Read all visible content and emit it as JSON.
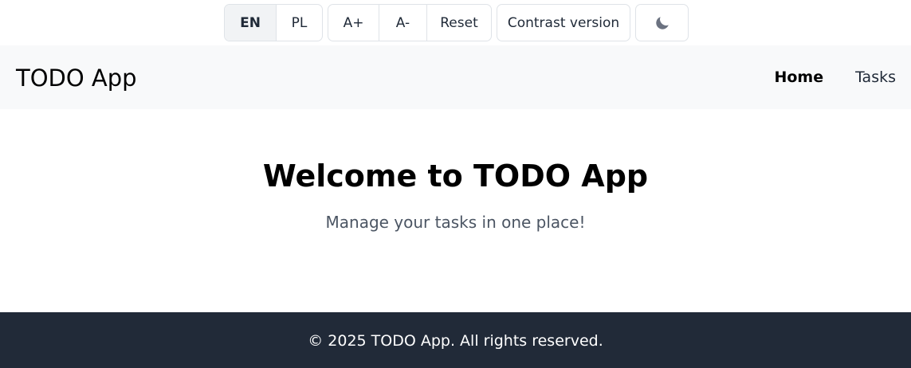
{
  "toolbar": {
    "language": {
      "en_label": "EN",
      "pl_label": "PL",
      "selected": "EN"
    },
    "font_size": {
      "increase_label": "A+",
      "decrease_label": "A-",
      "reset_label": "Reset"
    },
    "contrast_label": "Contrast version",
    "theme_icon": "moon-icon"
  },
  "navbar": {
    "brand": "TODO App",
    "links": [
      {
        "label": "Home",
        "active": true
      },
      {
        "label": "Tasks",
        "active": false
      }
    ]
  },
  "hero": {
    "title": "Welcome to TODO App",
    "subtitle": "Manage your tasks in one place!"
  },
  "footer": {
    "text": "© 2025 TODO App. All rights reserved."
  },
  "colors": {
    "navbar_bg": "#f8f9fa",
    "footer_bg": "#212a38",
    "active_button_bg": "#f1f3f5",
    "subtitle_text": "#4b5563",
    "moon_icon": "#6b7280"
  }
}
